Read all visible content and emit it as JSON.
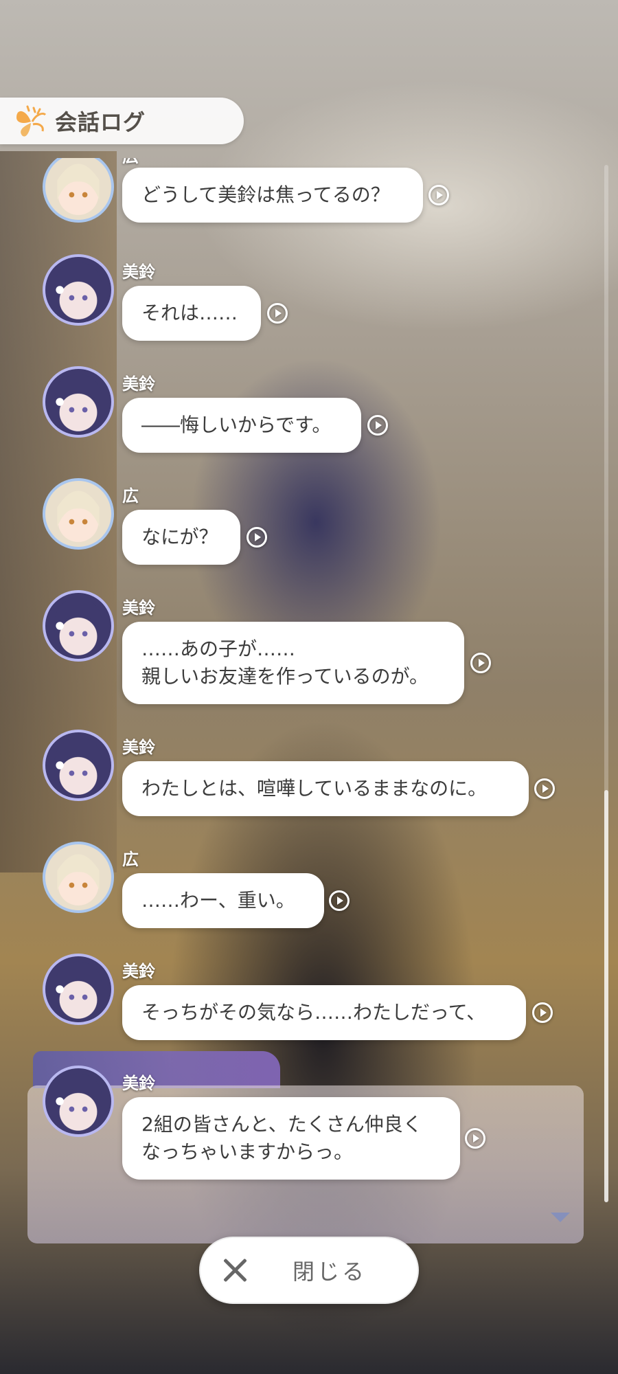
{
  "header": {
    "title": "会話ログ",
    "icon": "butterfly-logo-icon"
  },
  "entries": [
    {
      "speaker": "広",
      "character": "hiro",
      "text": "どうして美鈴は焦ってるの？"
    },
    {
      "speaker": "美鈴",
      "character": "misuzu",
      "text": "それは……"
    },
    {
      "speaker": "美鈴",
      "character": "misuzu",
      "text": "――悔しいからです。"
    },
    {
      "speaker": "広",
      "character": "hiro",
      "text": "なにが？"
    },
    {
      "speaker": "美鈴",
      "character": "misuzu",
      "text": "……あの子が……\n親しいお友達を作っているのが。"
    },
    {
      "speaker": "美鈴",
      "character": "misuzu",
      "text": "わたしとは、喧嘩しているままなのに。"
    },
    {
      "speaker": "広",
      "character": "hiro",
      "text": "……わー、重い。"
    },
    {
      "speaker": "美鈴",
      "character": "misuzu",
      "text": "そっちがその気なら……わたしだって、"
    },
    {
      "speaker": "美鈴",
      "character": "misuzu",
      "text": "2組の皆さんと、たくさん仲良く\nなっちゃいますからっ。"
    }
  ],
  "close_button": {
    "label": "閉じる",
    "icon": "close-x-icon"
  },
  "colors": {
    "bubble": "#ffffff",
    "text": "#3c3c3c",
    "avatar_border_misuzu": "#b9b8f0",
    "avatar_border_hiro": "#a9c6ee"
  }
}
